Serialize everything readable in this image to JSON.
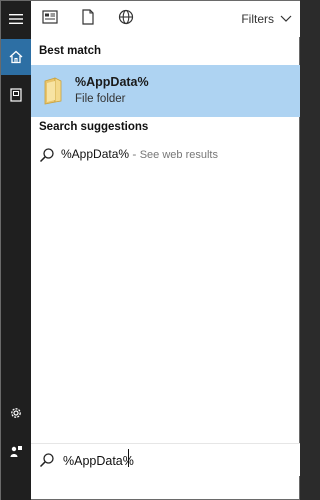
{
  "topbar": {
    "filters_label": "Filters",
    "icons": [
      "documents-icon",
      "file-icon",
      "globe-icon",
      "chevron-down-icon"
    ]
  },
  "rail": {
    "items": [
      "hamburger-menu-icon",
      "home-icon",
      "notebook-icon",
      "settings-icon",
      "feedback-icon"
    ],
    "active": "home-icon"
  },
  "best_match": {
    "title": "Best match",
    "result": {
      "name": "%AppData%",
      "subtitle": "File folder",
      "icon": "folder-icon"
    }
  },
  "suggestions": {
    "title": "Search suggestions",
    "items": [
      {
        "query": "%AppData%",
        "separator": " - ",
        "hint": "See web results",
        "icon": "search-icon"
      }
    ]
  },
  "search": {
    "value": "%AppData%",
    "icon": "search-icon"
  },
  "colors": {
    "rail_bg": "#1f1f1f",
    "rail_active": "#2d6fa4",
    "selected_row": "#aed3f2"
  }
}
